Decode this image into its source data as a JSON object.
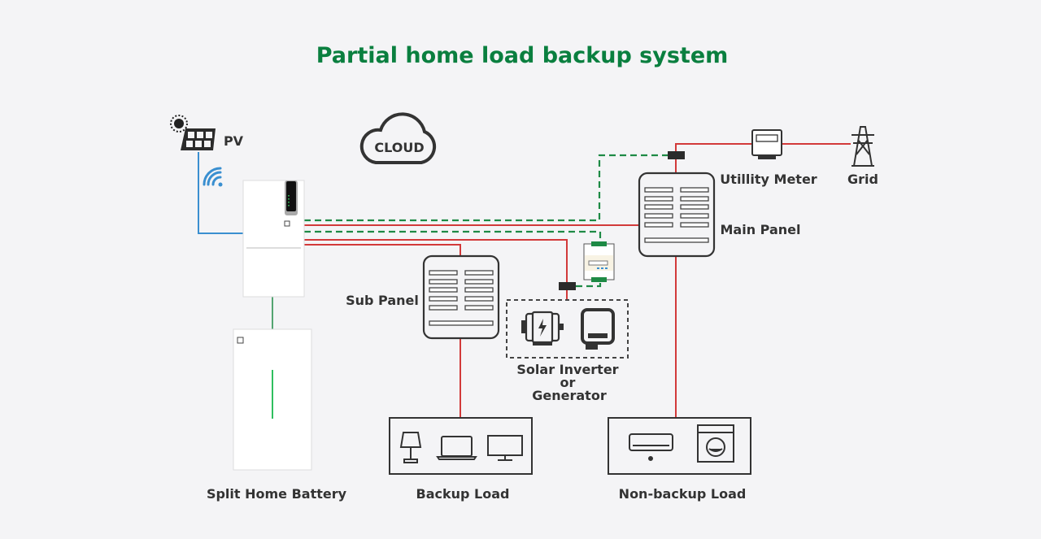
{
  "title": "Partial home load backup system",
  "colors": {
    "title": "#0a7f3f",
    "ac_line": "#d23a3a",
    "comm_line": "#1e8a45",
    "pv_line": "#3a8fd0"
  },
  "labels": {
    "pv": "PV",
    "cloud": "CLOUD",
    "utility_meter": "Utillity Meter",
    "grid": "Grid",
    "main_panel": "Main Panel",
    "sub_panel": "Sub Panel",
    "solar_inverter": "Solar Inverter",
    "or": "or",
    "generator": "Generator",
    "battery": "Split Home Battery",
    "backup_load": "Backup Load",
    "non_backup_load": "Non-backup Load"
  },
  "icons": [
    "sun-icon",
    "solar-panel-icon",
    "wifi-icon",
    "cloud-icon",
    "inverter",
    "battery",
    "main-panel-icon",
    "sub-panel-icon",
    "utility-meter-icon",
    "grid-tower-icon",
    "smart-meter-icon",
    "generator-icon",
    "solar-inverter-icon",
    "lamp-icon",
    "laptop-icon",
    "monitor-icon",
    "air-conditioner-icon",
    "washing-machine-icon"
  ]
}
